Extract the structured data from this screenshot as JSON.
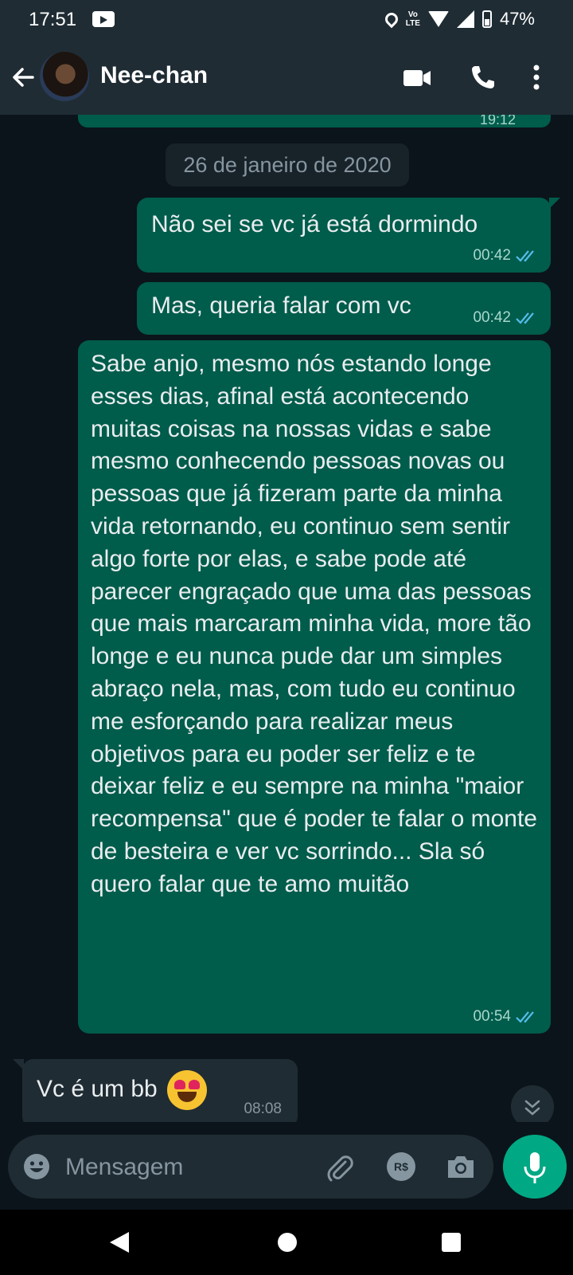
{
  "status_bar": {
    "time": "17:51",
    "volte": "Vo\nLTE",
    "battery": "47%"
  },
  "header": {
    "contact_name": "Nee-chan",
    "icons": [
      "back-arrow-icon",
      "avatar",
      "video-call-icon",
      "phone-icon",
      "more-menu-icon"
    ]
  },
  "chat": {
    "previous_time": "19:12",
    "date_separator": "26 de janeiro de 2020",
    "messages": [
      {
        "direction": "out",
        "text": "Não sei se vc já está dormindo",
        "time": "00:42",
        "status": "read"
      },
      {
        "direction": "out",
        "text": "Mas, queria falar com vc",
        "time": "00:42",
        "status": "read"
      },
      {
        "direction": "out",
        "text": "Sabe anjo, mesmo nós estando longe esses dias, afinal está acontecendo muitas coisas na nossas vidas e sabe mesmo conhecendo pessoas novas ou pessoas que já fizeram parte da minha vida retornando, eu continuo sem sentir algo forte por elas, e sabe pode até parecer engraçado que uma das pessoas que mais marcaram minha vida, more tão longe e eu nunca pude dar um simples abraço nela, mas, com tudo eu continuo me esforçando para realizar meus objetivos para eu poder ser feliz e te deixar feliz e eu sempre na minha \"maior recompensa\" que é poder te falar o monte de besteira e ver vc sorrindo... Sla só quero falar que te amo muitão",
        "time": "00:54",
        "status": "read"
      },
      {
        "direction": "in",
        "text": "Vc é um bb",
        "emoji": "heart-eyes",
        "time": "08:08"
      }
    ]
  },
  "composer": {
    "placeholder": "Mensagem",
    "pay_label": "R$"
  },
  "colors": {
    "background": "#0b141a",
    "header": "#1f2c34",
    "outgoing_bubble": "#005c4b",
    "incoming_bubble": "#202c33",
    "accent": "#00a884",
    "read_tick": "#53bdeb"
  }
}
